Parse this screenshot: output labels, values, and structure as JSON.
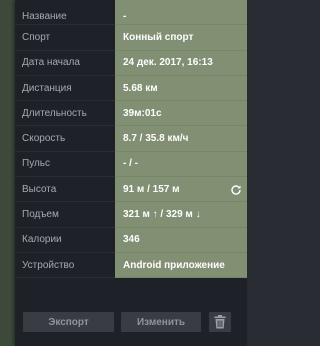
{
  "details": {
    "rows": [
      {
        "label": "Название",
        "value": "-"
      },
      {
        "label": "Спорт",
        "value": "Конный спорт"
      },
      {
        "label": "Дата начала",
        "value": "24 дек. 2017, 16:13"
      },
      {
        "label": "Дистанция",
        "value": "5.68 км"
      },
      {
        "label": "Длительность",
        "value": "39м:01с"
      },
      {
        "label": "Скорость",
        "value": "8.7 / 35.8 км/ч"
      },
      {
        "label": "Пульс",
        "value": "- / -"
      },
      {
        "label": "Высота",
        "value": "91 м / 157 м"
      },
      {
        "label": "Подъем",
        "value": "321 м ↑ / 329 м ↓"
      },
      {
        "label": "Калории",
        "value": "346"
      },
      {
        "label": "Устройство",
        "value": "Android приложение"
      }
    ]
  },
  "footer": {
    "export_label": "Экспорт",
    "edit_label": "Изменить"
  },
  "icons": {
    "reload": "refresh-icon",
    "delete": "trash-icon"
  }
}
